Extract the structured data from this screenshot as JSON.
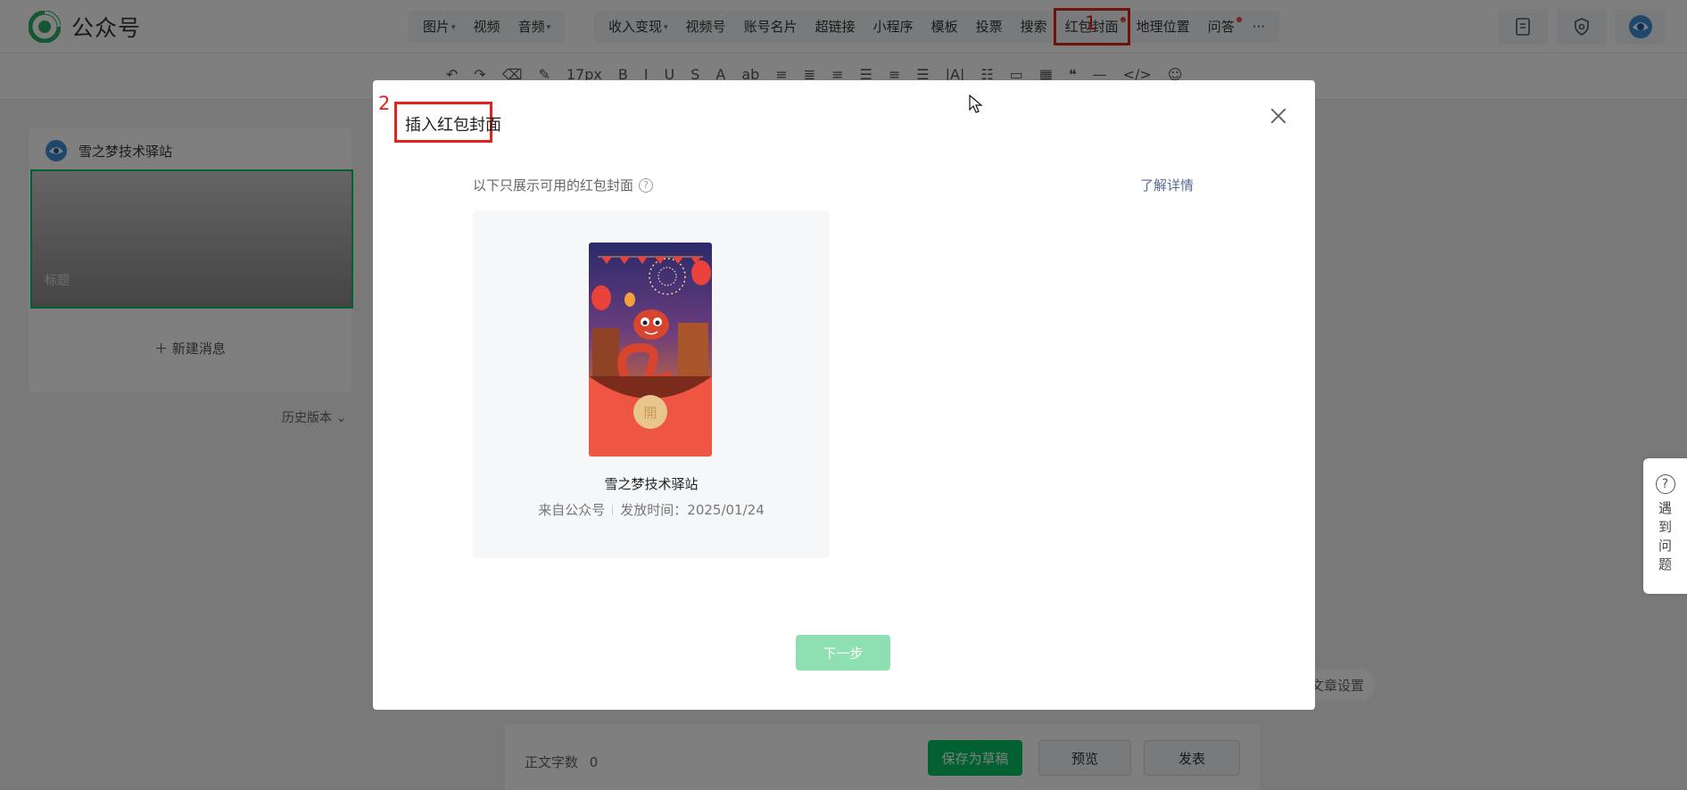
{
  "app": {
    "title": "公众号"
  },
  "topbar": {
    "menu_group_1": [
      {
        "label": "图片",
        "caret": "▾"
      },
      {
        "label": "视频",
        "caret": ""
      },
      {
        "label": "音频",
        "caret": "▾"
      }
    ],
    "menu_group_2": [
      {
        "label": "收入变现",
        "caret": "▾"
      },
      {
        "label": "视频号",
        "caret": ""
      },
      {
        "label": "账号名片",
        "caret": ""
      },
      {
        "label": "超链接",
        "caret": ""
      },
      {
        "label": "小程序",
        "caret": ""
      },
      {
        "label": "模板",
        "caret": ""
      },
      {
        "label": "投票",
        "caret": ""
      },
      {
        "label": "搜索",
        "caret": ""
      },
      {
        "label": "红包封面",
        "caret": ""
      },
      {
        "label": "地理位置",
        "caret": ""
      },
      {
        "label": "问答",
        "caret": ""
      },
      {
        "label": "···",
        "caret": ""
      }
    ],
    "icons": [
      "document-icon",
      "shield-icon",
      "avatar-icon"
    ]
  },
  "editor_toolbar": {
    "font_size": "17px",
    "items": [
      "↶",
      "↷",
      "⌫",
      "✎",
      "17px",
      "B",
      "I",
      "U",
      "S",
      "A",
      "ab",
      "≡",
      "≣",
      "≡",
      "☰",
      "≡",
      "☰",
      "|A|",
      "☷",
      "▭",
      "▦",
      "❝",
      "—",
      "</>",
      "☺"
    ]
  },
  "left_panel": {
    "account_name": "雪之梦技术驿站",
    "article_title_placeholder": "标题",
    "new_message": "新建消息",
    "history": "历史版本"
  },
  "bottom_bar": {
    "word_count_label": "正文字数",
    "word_count": "0",
    "save_draft": "保存为草稿",
    "preview": "预览",
    "publish": "发表",
    "article_settings": "文章设置"
  },
  "help_widget": {
    "label": "遇到问题"
  },
  "modal": {
    "title": "插入红包封面",
    "hint": "以下只展示可用的红包封面",
    "learn_more": "了解详情",
    "cover": {
      "name": "雪之梦技术驿站",
      "source": "来自公众号",
      "issue_time_label": "发放时间：",
      "issue_time": "2025/01/24"
    },
    "next_button": "下一步"
  },
  "annotations": {
    "step1": "1",
    "step2": "2"
  },
  "colors": {
    "brand_green": "#07c160",
    "annotation_red": "#e0231b",
    "link_blue": "#576b95",
    "disabled_green": "#8ee0b2"
  }
}
